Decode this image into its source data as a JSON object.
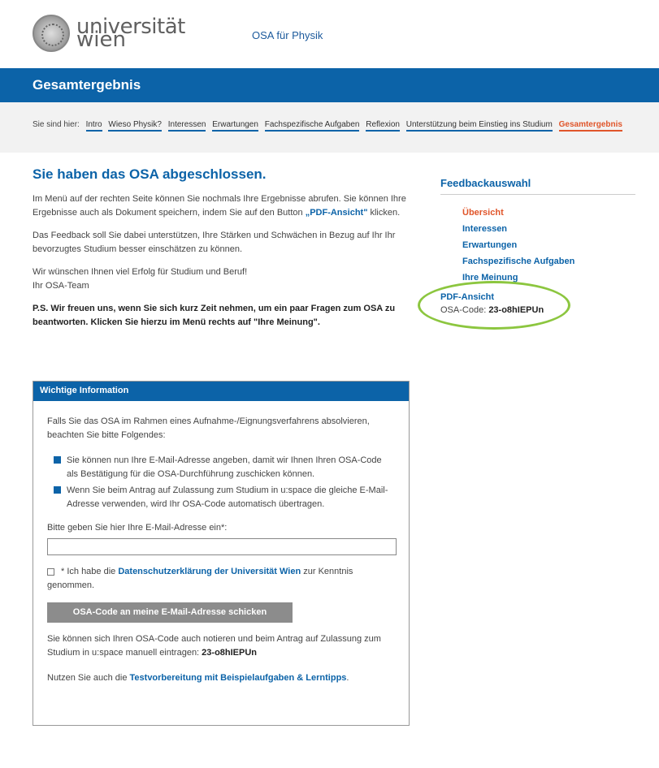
{
  "header": {
    "logo_line1": "universität",
    "logo_line2": "wien",
    "title": "OSA für Physik"
  },
  "titlebar": {
    "title": "Gesamtergebnis"
  },
  "breadcrumb": {
    "prefix": "Sie sind hier:",
    "items": [
      "Intro",
      "Wieso Physik?",
      "Interessen",
      "Erwartungen",
      "Fachspezifische Aufgaben",
      "Reflexion",
      "Unterstützung beim Einstieg ins Studium",
      "Gesamtergebnis"
    ]
  },
  "main": {
    "heading": "Sie haben das OSA abgeschlossen.",
    "p1_a": "Im Menü auf der rechten Seite können Sie nochmals Ihre Ergebnisse abrufen. Sie können Ihre Ergebnisse auch als Dokument speichern, indem Sie auf den Button ",
    "p1_link": "„PDF-Ansicht\"",
    "p1_b": " klicken.",
    "p2": "Das Feedback soll Sie dabei unterstützen, Ihre Stärken und Schwächen in Bezug auf Ihr Ihr bevorzugtes Studium besser einschätzen zu können.",
    "p3_line1": "Wir wünschen Ihnen viel Erfolg für Studium und Beruf!",
    "p3_line2": "Ihr OSA-Team",
    "ps": "P.S. Wir freuen uns, wenn Sie sich kurz Zeit nehmen, um ein paar Fragen zum OSA zu beantworten. Klicken Sie hierzu im Menü rechts auf \"Ihre Meinung\"."
  },
  "info": {
    "title": "Wichtige Information",
    "intro": "Falls Sie das OSA im Rahmen eines Aufnahme-/Eignungsverfahrens absolvieren, beachten Sie bitte Folgendes:",
    "bullets": [
      "Sie können nun Ihre E-Mail-Adresse angeben, damit wir Ihnen Ihren OSA-Code als Bestätigung für die OSA-Durchführung zuschicken können.",
      "Wenn Sie beim Antrag auf Zulassung zum Studium in u:space die gleiche E-Mail-Adresse verwenden, wird Ihr OSA-Code automatisch übertragen."
    ],
    "email_label": "Bitte geben Sie hier Ihre E-Mail-Adresse ein*:",
    "email_value": "",
    "consent_a": "* Ich habe die ",
    "consent_link": "Datenschutzerklärung der Universität Wien",
    "consent_b": " zur Kenntnis genommen.",
    "send_button": "OSA-Code an meine E-Mail-Adresse schicken",
    "note_a": "Sie können sich Ihren OSA-Code auch notieren und beim Antrag auf Zulassung zum Studium in u:space manuell eintragen: ",
    "note_code": "23-o8hIEPUn",
    "prep_a": "Nutzen Sie auch die ",
    "prep_link": "Testvorbereitung mit Beispielaufgaben & Lerntipps",
    "prep_b": "."
  },
  "side": {
    "heading": "Feedbackauswahl",
    "items": [
      "Übersicht",
      "Interessen",
      "Erwartungen",
      "Fachspezifische Aufgaben",
      "Ihre Meinung"
    ],
    "pdf": "PDF-Ansicht",
    "code_label": "OSA-Code: ",
    "code_value": "23-o8hIEPUn"
  }
}
